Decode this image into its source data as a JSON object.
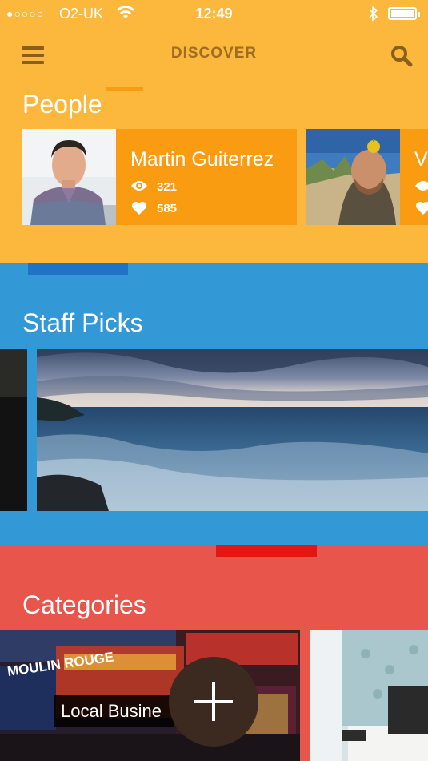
{
  "status_bar": {
    "signal": "●○○○○",
    "carrier": "O2-UK",
    "time": "12:49"
  },
  "nav": {
    "title": "DISCOVER",
    "menu_icon": "hamburger-menu-icon",
    "search_icon": "search-icon"
  },
  "people": {
    "title": "People",
    "cards": [
      {
        "name": "Martin Guiterrez",
        "views": "321",
        "likes": "585"
      },
      {
        "name": "Vi",
        "views": "",
        "likes": ""
      }
    ]
  },
  "staff_picks": {
    "title": "Staff Picks"
  },
  "categories": {
    "title": "Categories",
    "items": [
      {
        "label": "Local Busine",
        "sign_text": "MOULIN ROUGE"
      },
      {
        "label": ""
      }
    ]
  },
  "fab": {
    "icon": "plus-icon"
  },
  "colors": {
    "people_bg": "#fbb83d",
    "people_card": "#fa9c12",
    "staff_bg": "#3398d6",
    "categories_bg": "#e8554b",
    "fab": "#3c2a20"
  }
}
